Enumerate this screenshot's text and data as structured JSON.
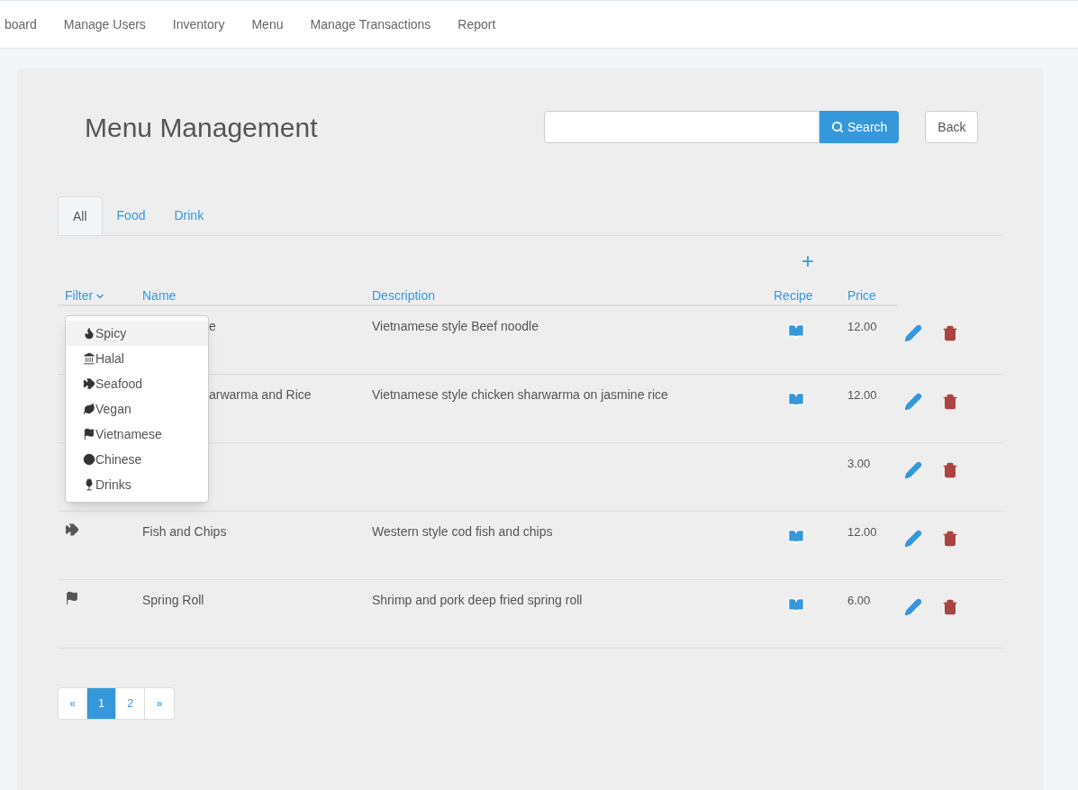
{
  "nav": [
    {
      "label": "board",
      "selected": false
    },
    {
      "label": "Manage Users",
      "selected": false
    },
    {
      "label": "Inventory",
      "selected": false
    },
    {
      "label": "Menu",
      "selected": false
    },
    {
      "label": "Manage Transactions",
      "selected": false
    },
    {
      "label": "Report",
      "selected": false
    }
  ],
  "title": "Menu Management",
  "search": {
    "button": "Search"
  },
  "back": "Back",
  "tabs": [
    {
      "label": "All",
      "selected": true
    },
    {
      "label": "Food",
      "selected": false
    },
    {
      "label": "Drink",
      "selected": false
    }
  ],
  "add_symbol": "+",
  "columns": {
    "filter": "Filter",
    "name": "Name",
    "description": "Description",
    "recipe": "Recipe",
    "price": "Price"
  },
  "filter_menu": {
    "open": true,
    "items": [
      {
        "kind": "spicy",
        "label": "Spicy",
        "selected": true
      },
      {
        "kind": "halal",
        "label": "Halal",
        "selected": false
      },
      {
        "kind": "seafood",
        "label": "Seafood",
        "selected": false
      },
      {
        "kind": "vegan",
        "label": "Vegan",
        "selected": false
      },
      {
        "kind": "vietnamese",
        "label": "Vietnamese",
        "selected": false
      },
      {
        "kind": "chinese",
        "label": "Chinese",
        "selected": false
      },
      {
        "kind": "drinks",
        "label": "Drinks",
        "selected": false
      }
    ]
  },
  "rows": [
    {
      "name": "e",
      "description": "Vietnamese style Beef noodle",
      "recipe": true,
      "price": "12.00"
    },
    {
      "name": "arwarma and Rice",
      "description": "Vietnamese style chicken sharwarma on jasmine rice",
      "recipe": true,
      "price": "12.00"
    },
    {
      "recipe": false,
      "price": "3.00"
    },
    {
      "kind": "seafood",
      "name": "Fish and Chips",
      "description": "Western style cod fish and chips",
      "recipe": true,
      "price": "12.00"
    },
    {
      "kind": "vietnamese",
      "name": "Spring Roll",
      "description": "Shrimp and pork deep fried spring roll",
      "recipe": true,
      "price": "6.00"
    }
  ],
  "pagination": [
    {
      "label": "«",
      "selected": false
    },
    {
      "label": "1",
      "selected": true
    },
    {
      "label": "2",
      "selected": false
    },
    {
      "label": "»",
      "selected": false
    }
  ]
}
